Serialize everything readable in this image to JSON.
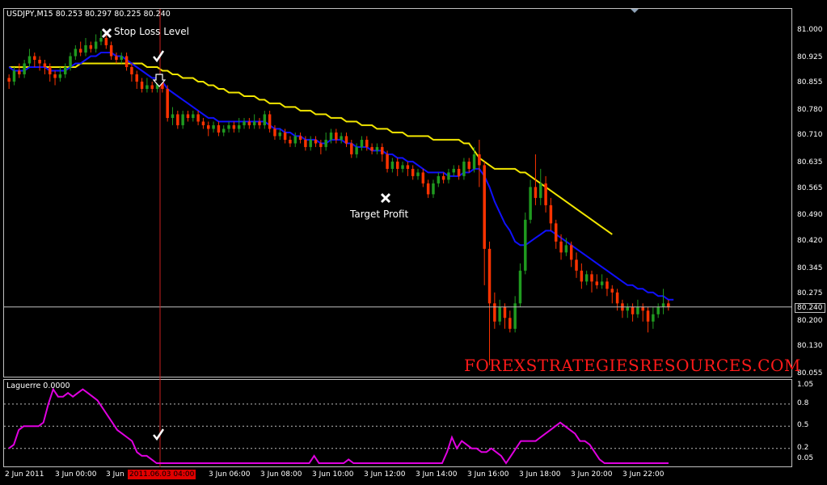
{
  "header": {
    "symbol_line": "USDJPY,M15  80.253 80.297 80.225 80.240"
  },
  "indicator": {
    "title": "Laguerre 0.0000"
  },
  "annotations": {
    "stop_loss": "Stop Loss Level",
    "target_profit": "Target Profit",
    "watermark": "FOREXSTRATEGIESRESOURCES.COM",
    "current_price": "80.240",
    "highlight_time": "2011.06.03 04:00"
  },
  "colors": {
    "bull": "#1f9a1f",
    "bear": "#ff3300",
    "ma_fast": "#1010ff",
    "ma_slow": "#f2e600",
    "laguerre": "#e000e0",
    "vline": "#c81e1e",
    "watermark": "#ff1a1a",
    "price_line": "#c0c0c0"
  },
  "icons": {
    "cross": "cross-icon",
    "check": "check-icon",
    "arrow": "down-arrow-icon"
  },
  "chart_data": {
    "type": "candlestick",
    "price_axis": {
      "ticks": [
        "81.000",
        "80.925",
        "80.855",
        "80.780",
        "80.710",
        "80.635",
        "80.565",
        "80.490",
        "80.420",
        "80.345",
        "80.275",
        "80.200",
        "80.130",
        "80.055"
      ],
      "ylim": [
        80.055,
        81.0
      ]
    },
    "indicator_axis": {
      "ticks": [
        "1.05",
        "0.8",
        "0.5",
        "0.2",
        "0.05"
      ],
      "levels": [
        0.8,
        0.5,
        0.2
      ]
    },
    "time_axis": {
      "labels": [
        "2 Jun 2011",
        "3 Jun 00:00",
        "3 Jun",
        "3 Jun 06:00",
        "3 Jun 08:00",
        "3 Jun 10:00",
        "3 Jun 12:00",
        "3 Jun 14:00",
        "3 Jun 16:00",
        "3 Jun 18:00",
        "3 Jun 20:00",
        "3 Jun 22:00"
      ]
    },
    "candles": [
      [
        80.87,
        80.86,
        80.88,
        80.84
      ],
      [
        80.86,
        80.89,
        80.9,
        80.85
      ],
      [
        80.89,
        80.88,
        80.91,
        80.87
      ],
      [
        80.88,
        80.91,
        80.92,
        80.87
      ],
      [
        80.91,
        80.93,
        80.95,
        80.9
      ],
      [
        80.93,
        80.92,
        80.94,
        80.9
      ],
      [
        80.92,
        80.91,
        80.93,
        80.89
      ],
      [
        80.91,
        80.9,
        80.92,
        80.88
      ],
      [
        80.9,
        80.88,
        80.91,
        80.86
      ],
      [
        80.88,
        80.87,
        80.89,
        80.85
      ],
      [
        80.87,
        80.88,
        80.9,
        80.86
      ],
      [
        80.88,
        80.9,
        80.91,
        80.87
      ],
      [
        80.9,
        80.93,
        80.94,
        80.89
      ],
      [
        80.93,
        80.95,
        80.96,
        80.92
      ],
      [
        80.95,
        80.94,
        80.97,
        80.93
      ],
      [
        80.94,
        80.96,
        80.98,
        80.93
      ],
      [
        80.96,
        80.95,
        80.97,
        80.94
      ],
      [
        80.95,
        80.97,
        80.99,
        80.94
      ],
      [
        80.97,
        80.98,
        81.0,
        80.96
      ],
      [
        80.98,
        80.96,
        80.99,
        80.95
      ],
      [
        80.96,
        80.93,
        80.97,
        80.92
      ],
      [
        80.93,
        80.92,
        80.94,
        80.91
      ],
      [
        80.92,
        80.93,
        80.94,
        80.91
      ],
      [
        80.93,
        80.9,
        80.94,
        80.89
      ],
      [
        80.9,
        80.88,
        80.91,
        80.86
      ],
      [
        80.88,
        80.86,
        80.89,
        80.84
      ],
      [
        80.86,
        80.84,
        80.87,
        80.83
      ],
      [
        80.84,
        80.85,
        80.87,
        80.83
      ],
      [
        80.85,
        80.84,
        80.86,
        80.83
      ],
      [
        80.84,
        80.86,
        80.88,
        80.83
      ],
      [
        80.86,
        80.84,
        80.87,
        80.83
      ],
      [
        80.84,
        80.76,
        80.85,
        80.75
      ],
      [
        80.76,
        80.77,
        80.79,
        80.74
      ],
      [
        80.77,
        80.74,
        80.78,
        80.73
      ],
      [
        80.74,
        80.77,
        80.78,
        80.73
      ],
      [
        80.77,
        80.76,
        80.78,
        80.75
      ],
      [
        80.76,
        80.77,
        80.78,
        80.75
      ],
      [
        80.77,
        80.75,
        80.78,
        80.74
      ],
      [
        80.75,
        80.74,
        80.76,
        80.73
      ],
      [
        80.74,
        80.73,
        80.75,
        80.71
      ],
      [
        80.73,
        80.74,
        80.75,
        80.72
      ],
      [
        80.74,
        80.72,
        80.75,
        80.71
      ],
      [
        80.72,
        80.73,
        80.74,
        80.71
      ],
      [
        80.73,
        80.74,
        80.75,
        80.72
      ],
      [
        80.74,
        80.73,
        80.75,
        80.72
      ],
      [
        80.73,
        80.74,
        80.76,
        80.72
      ],
      [
        80.74,
        80.75,
        80.76,
        80.73
      ],
      [
        80.75,
        80.74,
        80.76,
        80.73
      ],
      [
        80.74,
        80.75,
        80.77,
        80.73
      ],
      [
        80.75,
        80.74,
        80.76,
        80.73
      ],
      [
        80.74,
        80.77,
        80.78,
        80.73
      ],
      [
        80.77,
        80.73,
        80.78,
        80.72
      ],
      [
        80.73,
        80.71,
        80.74,
        80.7
      ],
      [
        80.71,
        80.72,
        80.73,
        80.7
      ],
      [
        80.72,
        80.7,
        80.73,
        80.69
      ],
      [
        80.7,
        80.69,
        80.71,
        80.68
      ],
      [
        80.69,
        80.71,
        80.72,
        80.68
      ],
      [
        80.71,
        80.7,
        80.72,
        80.69
      ],
      [
        80.7,
        80.68,
        80.71,
        80.67
      ],
      [
        80.68,
        80.7,
        80.71,
        80.67
      ],
      [
        80.7,
        80.69,
        80.71,
        80.68
      ],
      [
        80.69,
        80.68,
        80.7,
        80.66
      ],
      [
        80.68,
        80.7,
        80.72,
        80.67
      ],
      [
        80.7,
        80.72,
        80.73,
        80.69
      ],
      [
        80.72,
        80.7,
        80.73,
        80.69
      ],
      [
        80.7,
        80.71,
        80.72,
        80.69
      ],
      [
        80.71,
        80.69,
        80.72,
        80.68
      ],
      [
        80.69,
        80.66,
        80.7,
        80.65
      ],
      [
        80.66,
        80.68,
        80.69,
        80.65
      ],
      [
        80.68,
        80.7,
        80.71,
        80.67
      ],
      [
        80.7,
        80.68,
        80.71,
        80.67
      ],
      [
        80.68,
        80.67,
        80.69,
        80.66
      ],
      [
        80.67,
        80.68,
        80.69,
        80.66
      ],
      [
        80.68,
        80.66,
        80.69,
        80.64
      ],
      [
        80.66,
        80.62,
        80.67,
        80.61
      ],
      [
        80.62,
        80.64,
        80.65,
        80.61
      ],
      [
        80.64,
        80.62,
        80.65,
        80.6
      ],
      [
        80.62,
        80.63,
        80.64,
        80.61
      ],
      [
        80.63,
        80.62,
        80.64,
        80.6
      ],
      [
        80.62,
        80.6,
        80.63,
        80.59
      ],
      [
        80.6,
        80.61,
        80.62,
        80.59
      ],
      [
        80.61,
        80.58,
        80.62,
        80.57
      ],
      [
        80.58,
        80.55,
        80.59,
        80.54
      ],
      [
        80.55,
        80.58,
        80.59,
        80.54
      ],
      [
        80.58,
        80.6,
        80.61,
        80.57
      ],
      [
        80.6,
        80.59,
        80.61,
        80.58
      ],
      [
        80.59,
        80.61,
        80.62,
        80.58
      ],
      [
        80.61,
        80.62,
        80.63,
        80.6
      ],
      [
        80.62,
        80.6,
        80.63,
        80.59
      ],
      [
        80.6,
        80.64,
        80.65,
        80.59
      ],
      [
        80.64,
        80.62,
        80.65,
        80.61
      ],
      [
        80.62,
        80.66,
        80.68,
        80.61
      ],
      [
        80.66,
        80.63,
        80.7,
        80.57
      ],
      [
        80.63,
        80.4,
        80.64,
        80.3
      ],
      [
        80.4,
        80.25,
        80.42,
        80.08
      ],
      [
        80.25,
        80.2,
        80.28,
        80.18
      ],
      [
        80.2,
        80.24,
        80.26,
        80.19
      ],
      [
        80.24,
        80.21,
        80.25,
        80.18
      ],
      [
        80.21,
        80.18,
        80.23,
        80.17
      ],
      [
        80.18,
        80.25,
        80.27,
        80.17
      ],
      [
        80.25,
        80.34,
        80.36,
        80.24
      ],
      [
        80.34,
        80.48,
        80.5,
        80.33
      ],
      [
        80.48,
        80.57,
        80.59,
        80.47
      ],
      [
        80.57,
        80.54,
        80.66,
        80.52
      ],
      [
        80.54,
        80.58,
        80.62,
        80.52
      ],
      [
        80.58,
        80.52,
        80.6,
        80.5
      ],
      [
        80.52,
        80.47,
        80.54,
        80.45
      ],
      [
        80.47,
        80.42,
        80.48,
        80.4
      ],
      [
        80.42,
        80.39,
        80.44,
        80.37
      ],
      [
        80.39,
        80.41,
        80.43,
        80.38
      ],
      [
        80.41,
        80.37,
        80.42,
        80.35
      ],
      [
        80.37,
        80.34,
        80.39,
        80.32
      ],
      [
        80.34,
        80.31,
        80.36,
        80.29
      ],
      [
        80.31,
        80.33,
        80.34,
        80.3
      ],
      [
        80.33,
        80.31,
        80.34,
        80.28
      ],
      [
        80.31,
        80.3,
        80.33,
        80.29
      ],
      [
        80.3,
        80.31,
        80.33,
        80.29
      ],
      [
        80.31,
        80.29,
        80.32,
        80.27
      ],
      [
        80.29,
        80.28,
        80.3,
        80.25
      ],
      [
        80.28,
        80.25,
        80.29,
        80.23
      ],
      [
        80.25,
        80.23,
        80.26,
        80.21
      ],
      [
        80.23,
        80.24,
        80.25,
        80.21
      ],
      [
        80.24,
        80.22,
        80.25,
        80.2
      ],
      [
        80.22,
        80.24,
        80.26,
        80.21
      ],
      [
        80.24,
        80.23,
        80.25,
        80.2
      ],
      [
        80.23,
        80.2,
        80.24,
        80.17
      ],
      [
        80.2,
        80.22,
        80.24,
        80.18
      ],
      [
        80.22,
        80.24,
        80.25,
        80.21
      ],
      [
        80.24,
        80.25,
        80.29,
        80.22
      ],
      [
        80.25,
        80.24,
        80.26,
        80.23
      ]
    ],
    "ma_fast": [
      80.9,
      80.89,
      80.89,
      80.89,
      80.9,
      80.9,
      80.9,
      80.9,
      80.89,
      80.89,
      80.89,
      80.89,
      80.9,
      80.91,
      80.91,
      80.92,
      80.93,
      80.93,
      80.94,
      80.94,
      80.94,
      80.93,
      80.93,
      80.92,
      80.91,
      80.9,
      80.89,
      80.88,
      80.87,
      80.87,
      80.86,
      80.84,
      80.83,
      80.82,
      80.81,
      80.8,
      80.79,
      80.78,
      80.77,
      80.76,
      80.76,
      80.75,
      80.75,
      80.75,
      80.75,
      80.75,
      80.75,
      80.75,
      80.75,
      80.75,
      80.75,
      80.74,
      80.73,
      80.73,
      80.72,
      80.72,
      80.71,
      80.71,
      80.7,
      80.7,
      80.7,
      80.69,
      80.69,
      80.7,
      80.7,
      80.7,
      80.69,
      80.69,
      80.68,
      80.68,
      80.68,
      80.67,
      80.67,
      80.67,
      80.66,
      80.66,
      80.65,
      80.65,
      80.64,
      80.64,
      80.63,
      80.62,
      80.61,
      80.61,
      80.61,
      80.61,
      80.6,
      80.6,
      80.6,
      80.61,
      80.61,
      80.62,
      80.62,
      80.6,
      80.57,
      80.53,
      80.5,
      80.47,
      80.45,
      80.42,
      80.41,
      80.41,
      80.42,
      80.43,
      80.44,
      80.45,
      80.45,
      80.44,
      80.43,
      80.42,
      80.41,
      80.4,
      80.39,
      80.38,
      80.37,
      80.36,
      80.35,
      80.34,
      80.33,
      80.32,
      80.31,
      80.3,
      80.3,
      80.29,
      80.29,
      80.28,
      80.28,
      80.27,
      80.27,
      80.26,
      80.26
    ],
    "ma_slow": [
      80.9,
      80.9,
      80.9,
      80.9,
      80.9,
      80.9,
      80.9,
      80.9,
      80.9,
      80.9,
      80.9,
      80.9,
      80.9,
      80.9,
      80.91,
      80.91,
      80.91,
      80.91,
      80.91,
      80.91,
      80.91,
      80.91,
      80.91,
      80.91,
      80.91,
      80.91,
      80.91,
      80.9,
      80.9,
      80.9,
      80.89,
      80.89,
      80.88,
      80.88,
      80.87,
      80.87,
      80.87,
      80.86,
      80.86,
      80.85,
      80.85,
      80.84,
      80.84,
      80.83,
      80.83,
      80.83,
      80.82,
      80.82,
      80.82,
      80.81,
      80.81,
      80.8,
      80.8,
      80.8,
      80.79,
      80.79,
      80.79,
      80.78,
      80.78,
      80.78,
      80.77,
      80.77,
      80.77,
      80.76,
      80.76,
      80.76,
      80.75,
      80.75,
      80.75,
      80.74,
      80.74,
      80.74,
      80.73,
      80.73,
      80.73,
      80.72,
      80.72,
      80.72,
      80.71,
      80.71,
      80.71,
      80.71,
      80.71,
      80.7,
      80.7,
      80.7,
      80.7,
      80.7,
      80.7,
      80.69,
      80.69,
      80.67,
      80.65,
      80.64,
      80.63,
      80.62,
      80.62,
      80.62,
      80.62,
      80.62,
      80.61,
      80.61,
      80.6,
      80.59,
      80.58,
      80.57,
      80.56,
      80.55,
      80.54,
      80.53,
      80.52,
      80.51,
      80.5,
      80.49,
      80.48,
      80.47,
      80.46,
      80.45,
      80.44
    ],
    "laguerre": [
      0.2,
      0.25,
      0.45,
      0.5,
      0.5,
      0.5,
      0.5,
      0.55,
      0.8,
      1.0,
      0.9,
      0.9,
      0.95,
      0.9,
      0.95,
      1.0,
      0.95,
      0.9,
      0.85,
      0.75,
      0.65,
      0.55,
      0.45,
      0.4,
      0.35,
      0.3,
      0.15,
      0.1,
      0.1,
      0.05,
      0.0,
      0.0,
      0.0,
      0.0,
      0.0,
      0.0,
      0.0,
      0.0,
      0.0,
      0.0,
      0.0,
      0.0,
      0.0,
      0.0,
      0.0,
      0.0,
      0.0,
      0.0,
      0.0,
      0.0,
      0.0,
      0.0,
      0.0,
      0.0,
      0.0,
      0.0,
      0.0,
      0.0,
      0.0,
      0.0,
      0.0,
      0.0,
      0.1,
      0.0,
      0.0,
      0.0,
      0.0,
      0.0,
      0.0,
      0.05,
      0.0,
      0.0,
      0.0,
      0.0,
      0.0,
      0.0,
      0.0,
      0.0,
      0.0,
      0.0,
      0.0,
      0.0,
      0.0,
      0.0,
      0.0,
      0.0,
      0.0,
      0.0,
      0.0,
      0.15,
      0.35,
      0.2,
      0.3,
      0.25,
      0.2,
      0.2,
      0.15,
      0.15,
      0.2,
      0.15,
      0.1,
      0.0,
      0.1,
      0.2,
      0.3,
      0.3,
      0.3,
      0.3,
      0.35,
      0.4,
      0.45,
      0.5,
      0.55,
      0.5,
      0.45,
      0.4,
      0.3,
      0.3,
      0.25,
      0.15,
      0.05,
      0.0,
      0.0,
      0.0,
      0.0,
      0.0,
      0.0,
      0.0,
      0.0,
      0.0,
      0.0,
      0.0,
      0.0,
      0.0,
      0.0
    ]
  }
}
